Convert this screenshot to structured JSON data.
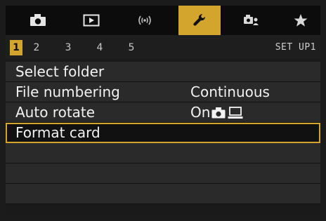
{
  "tabs": [
    {
      "icon": "camera-icon",
      "active": false
    },
    {
      "icon": "playback-icon",
      "active": false
    },
    {
      "icon": "wireless-icon",
      "active": false
    },
    {
      "icon": "wrench-icon",
      "active": true
    },
    {
      "icon": "custom-functions-icon",
      "active": false
    },
    {
      "icon": "star-icon",
      "active": false
    }
  ],
  "subtabs": [
    "1",
    "2",
    "3",
    "4",
    "5"
  ],
  "menu_name": "SET UP1",
  "items": [
    {
      "label": "Select folder",
      "value": ""
    },
    {
      "label": "File numbering",
      "value": "Continuous"
    },
    {
      "label": "Auto rotate",
      "value": "On",
      "value_icons": [
        "camera-icon",
        "computer-icon"
      ]
    },
    {
      "label": "Format card",
      "value": "",
      "selected": true
    },
    {
      "label": "",
      "value": ""
    },
    {
      "label": "",
      "value": ""
    },
    {
      "label": "",
      "value": ""
    }
  ],
  "colors": {
    "accent": "#d4a52d",
    "background": "#1a1a1a",
    "row": "#2a2a2a"
  }
}
